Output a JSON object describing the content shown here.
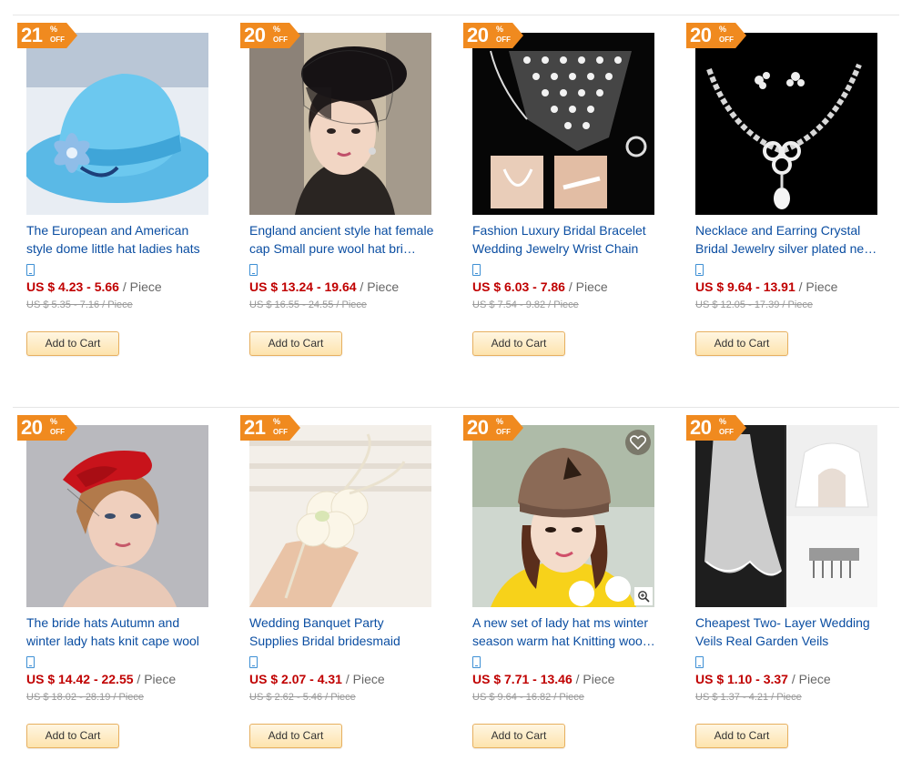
{
  "add_to_cart_label": "Add to Cart",
  "colors": {
    "badge": "#f08a1f",
    "title_link": "#0b4ea2",
    "price": "#c00000",
    "cart_button_top": "#fff6e2",
    "cart_button_bottom": "#fde3ad"
  },
  "products": [
    {
      "discount": "21",
      "pct": "%",
      "off": "OFF",
      "title": "The European and American style dome little hat ladies hats",
      "price": "US $ 4.23 - 5.66",
      "unit": " / Piece",
      "old_price": "US $ 5.35 - 7.16 / Piece",
      "image": "blue-straw-hat-photo"
    },
    {
      "discount": "20",
      "pct": "%",
      "off": "OFF",
      "title": "England ancient style hat female cap Small pure wool hat bri…",
      "price": "US $ 13.24 - 19.64",
      "unit": " / Piece",
      "old_price": "US $ 16.55 - 24.55 / Piece",
      "image": "black-veil-hat-woman-photo"
    },
    {
      "discount": "20",
      "pct": "%",
      "off": "OFF",
      "title": "Fashion Luxury Bridal Bracelet Wedding Jewelry Wrist Chain",
      "price": "US $ 6.03 - 7.86",
      "unit": " / Piece",
      "old_price": "US $ 7.54 - 9.82 / Piece",
      "image": "crystal-wrist-chain-photo"
    },
    {
      "discount": "20",
      "pct": "%",
      "off": "OFF",
      "title": "Necklace and Earring Crystal Bridal Jewelry silver plated ne…",
      "price": "US $ 9.64 - 13.91",
      "unit": " / Piece",
      "old_price": "US $ 12.05 - 17.39 / Piece",
      "image": "crystal-necklace-set-photo"
    },
    {
      "discount": "20",
      "pct": "%",
      "off": "OFF",
      "title": "The bride hats Autumn and winter lady hats knit cape wool",
      "price": "US $ 14.42 - 22.55",
      "unit": " / Piece",
      "old_price": "US $ 18.02 - 28.19 / Piece",
      "image": "red-fascinator-woman-photo"
    },
    {
      "discount": "21",
      "pct": "%",
      "off": "OFF",
      "title": "Wedding Banquet Party Supplies Bridal bridesmaid",
      "price": "US $ 2.07 - 4.31",
      "unit": " / Piece",
      "old_price": "US $ 2.62 - 5.46 / Piece",
      "image": "wrist-corsage-photo"
    },
    {
      "discount": "20",
      "pct": "%",
      "off": "OFF",
      "title": "A new set of lady hat ms winter season warm hat Knitting woo…",
      "price": "US $ 7.71 - 13.46",
      "unit": " / Piece",
      "old_price": "US $ 9.64 - 16.82 / Piece",
      "image": "knit-beanie-woman-photo"
    },
    {
      "discount": "20",
      "pct": "%",
      "off": "OFF",
      "title": "Cheapest Two- Layer Wedding Veils Real Garden Veils",
      "price": "US $ 1.10 - 3.37",
      "unit": " / Piece",
      "old_price": "US $ 1.37 - 4.21 / Piece",
      "image": "wedding-veil-photo"
    }
  ]
}
